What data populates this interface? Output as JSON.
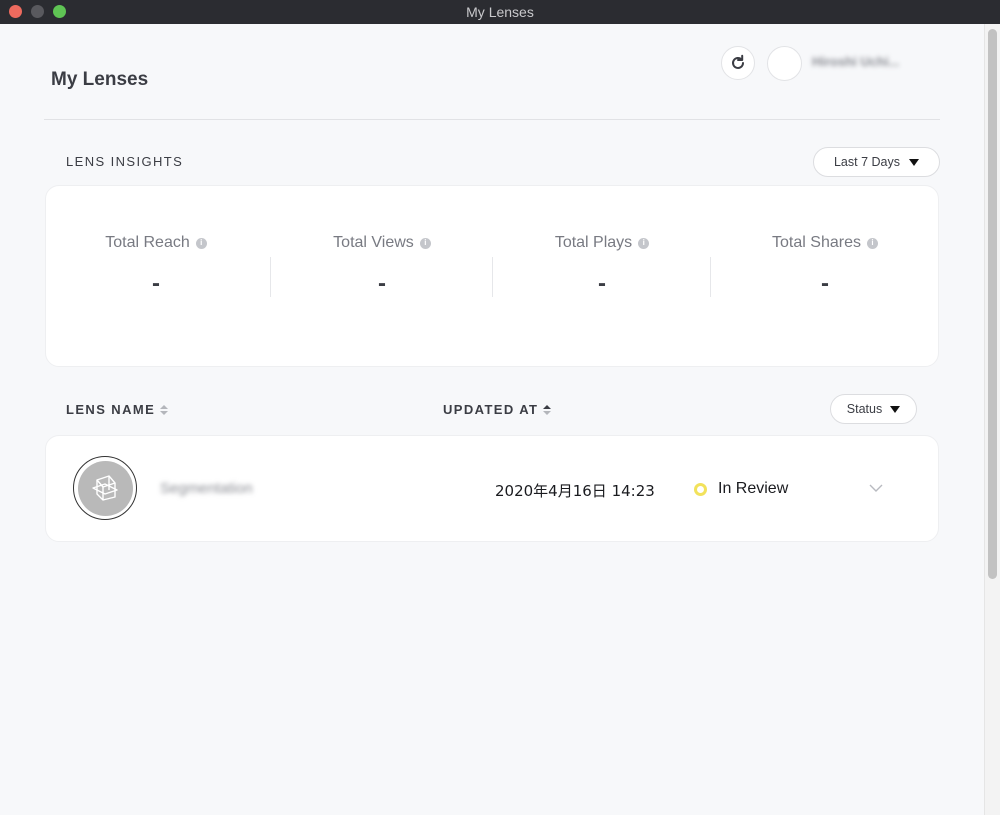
{
  "window": {
    "title": "My Lenses"
  },
  "header": {
    "title": "My Lenses",
    "user_name": "Hiroshi Uchi..."
  },
  "insights": {
    "section_label": "LENS INSIGHTS",
    "range": "Last 7 Days",
    "stats": [
      {
        "label": "Total Reach",
        "value": "-"
      },
      {
        "label": "Total Views",
        "value": "-"
      },
      {
        "label": "Total Plays",
        "value": "-"
      },
      {
        "label": "Total Shares",
        "value": "-"
      }
    ]
  },
  "table": {
    "columns": {
      "lens_name": "LENS NAME",
      "updated_at": "UPDATED AT"
    },
    "status_filter": "Status",
    "rows": [
      {
        "name": "Segmentation",
        "updated_at": "2020年4月16日 14:23",
        "status": "In Review",
        "status_color": "#f2e25c"
      }
    ]
  }
}
